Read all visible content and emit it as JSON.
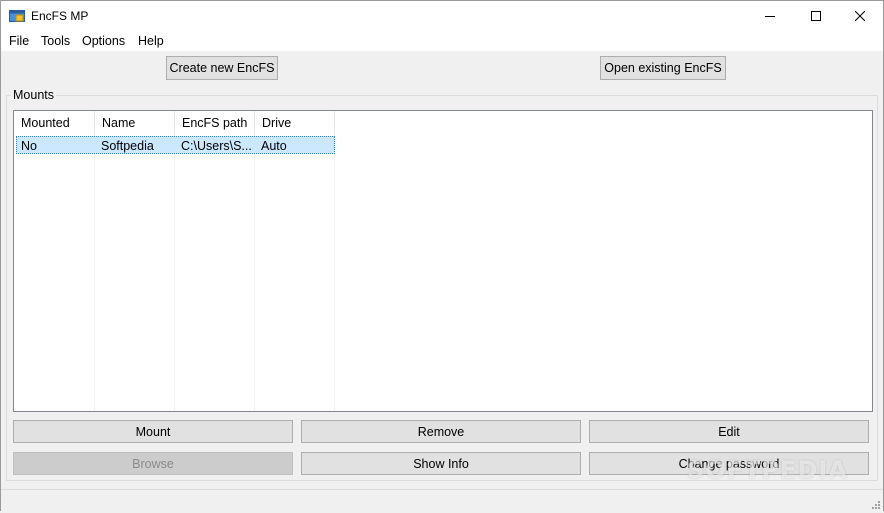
{
  "window": {
    "title": "EncFS MP",
    "icon": "encfs-app-icon",
    "controls": [
      "minimize-icon",
      "maximize-icon",
      "close-icon"
    ]
  },
  "menu": {
    "items": [
      {
        "label": "File"
      },
      {
        "label": "Tools"
      },
      {
        "label": "Options"
      },
      {
        "label": "Help"
      }
    ]
  },
  "toolbar": {
    "create_label": "Create new EncFS",
    "open_label": "Open existing EncFS"
  },
  "mounts": {
    "group_label": "Mounts",
    "columns": [
      "Mounted",
      "Name",
      "EncFS path",
      "Drive"
    ],
    "rows": [
      {
        "mounted": "No",
        "name": "Softpedia",
        "path": "C:\\Users\\S...",
        "drive": "Auto",
        "selected": true
      }
    ]
  },
  "actions": {
    "mount_label": "Mount",
    "remove_label": "Remove",
    "edit_label": "Edit",
    "browse_label": "Browse",
    "show_info_label": "Show Info",
    "change_password_label": "Change password"
  },
  "watermark": "SOFTPEDIA",
  "colors": {
    "selection": "#cce8ff",
    "button_face": "#e1e1e1",
    "button_disabled": "#cccccc"
  }
}
